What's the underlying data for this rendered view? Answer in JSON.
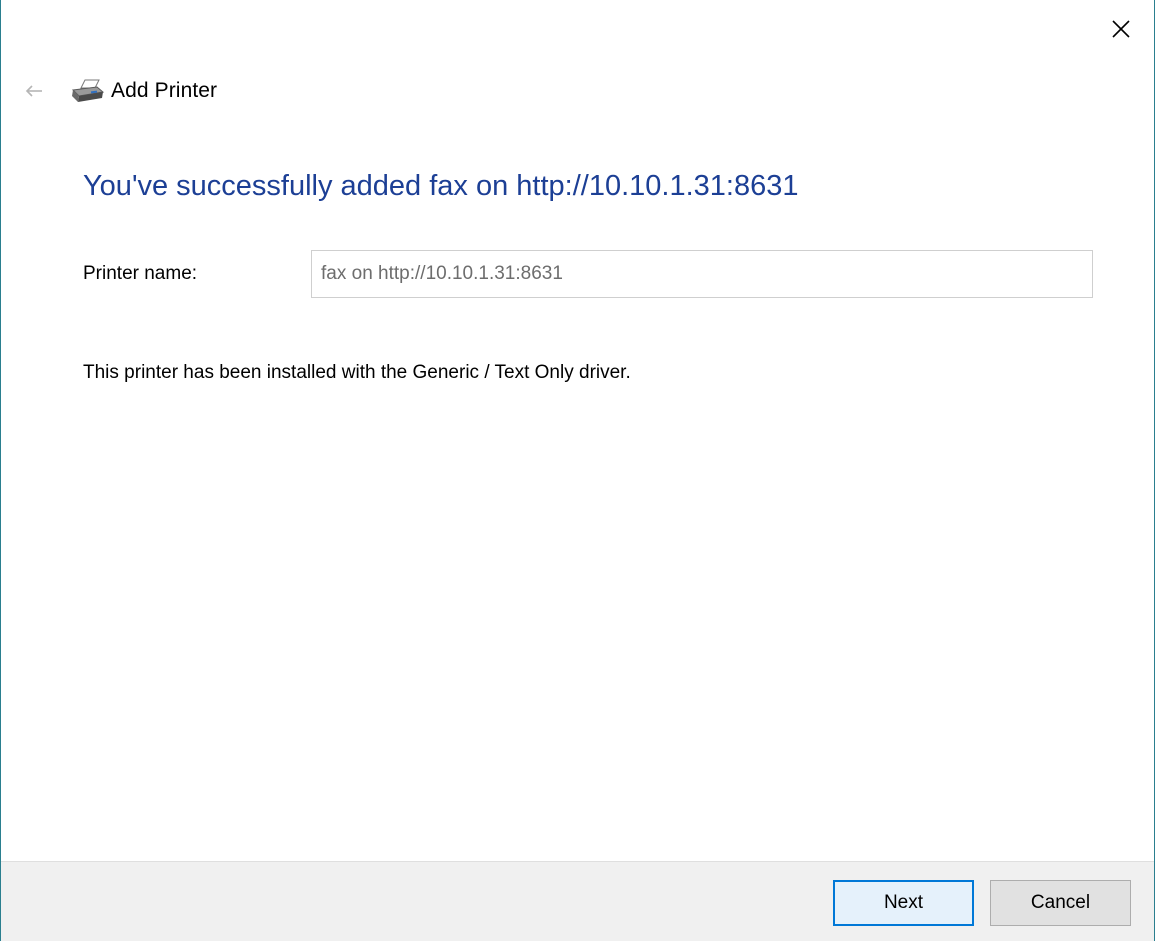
{
  "window": {
    "title": "Add Printer"
  },
  "icons": {
    "close": "close-icon",
    "back": "back-arrow-icon",
    "printer": "printer-icon"
  },
  "content": {
    "headline": "You've successfully added fax on http://10.10.1.31:8631",
    "printer_name_label": "Printer name:",
    "printer_name_value": "fax on http://10.10.1.31:8631",
    "driver_text": "This printer has been installed with the Generic / Text Only driver."
  },
  "footer": {
    "next_label": "Next",
    "cancel_label": "Cancel"
  },
  "colors": {
    "headline": "#1c3f95",
    "accent": "#0078d7",
    "footer_bg": "#f0f0f0"
  }
}
